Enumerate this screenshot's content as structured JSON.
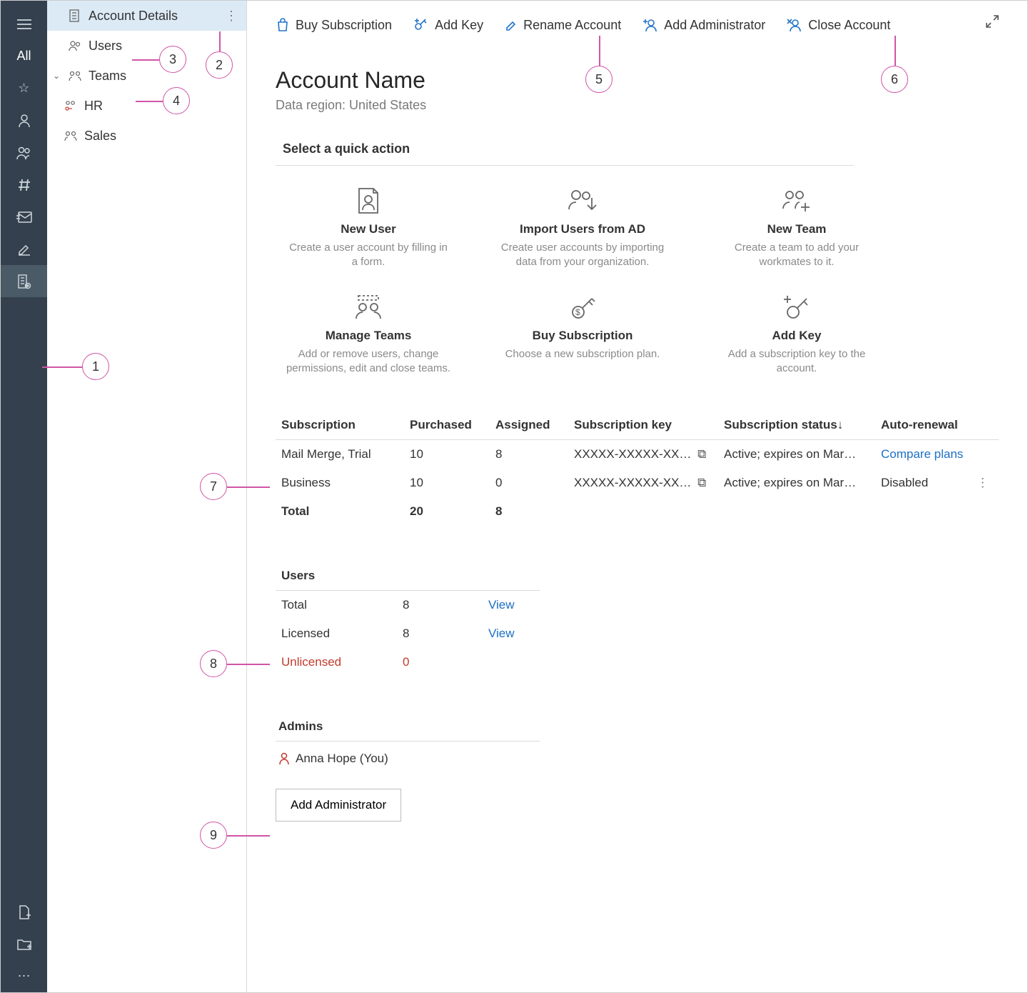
{
  "rail": {
    "text_item": "All"
  },
  "nav": {
    "account_details": "Account Details",
    "users": "Users",
    "teams": "Teams",
    "team_items": [
      "HR",
      "Sales"
    ]
  },
  "toolbar": {
    "buy": "Buy Subscription",
    "add_key": "Add Key",
    "rename": "Rename Account",
    "add_admin": "Add Administrator",
    "close": "Close Account"
  },
  "header": {
    "title": "Account Name",
    "region": "Data region: United States"
  },
  "quick_actions": {
    "title": "Select a quick action",
    "cards": [
      {
        "title": "New User",
        "desc": "Create a user account by filling in a form."
      },
      {
        "title": "Import Users from AD",
        "desc": "Create user accounts by importing data from your organization."
      },
      {
        "title": "New Team",
        "desc": "Create a team to add your workmates to it."
      },
      {
        "title": "Manage Teams",
        "desc": "Add or remove users, change permissions, edit and close teams."
      },
      {
        "title": "Buy Subscription",
        "desc": "Choose a new subscription plan."
      },
      {
        "title": "Add Key",
        "desc": "Add a subscription key to the account."
      }
    ]
  },
  "subs": {
    "headers": {
      "sub": "Subscription",
      "purchased": "Purchased",
      "assigned": "Assigned",
      "key": "Subscription key",
      "status": "Subscription status",
      "auto": "Auto-renewal"
    },
    "rows": [
      {
        "name": "Mail Merge, Trial",
        "purchased": "10",
        "assigned": "8",
        "key": "XXXXX-XXXXX-XX…",
        "status": "Active; expires on Mar…",
        "auto": "Compare plans",
        "auto_link": true
      },
      {
        "name": "Business",
        "purchased": "10",
        "assigned": "0",
        "key": "XXXXX-XXXXX-XX…",
        "status": "Active; expires on Mar…",
        "auto": "Disabled",
        "auto_link": false
      }
    ],
    "total": {
      "label": "Total",
      "purchased": "20",
      "assigned": "8"
    }
  },
  "users": {
    "header": "Users",
    "rows": [
      {
        "label": "Total",
        "value": "8",
        "action": "View",
        "red": false
      },
      {
        "label": "Licensed",
        "value": "8",
        "action": "View",
        "red": false
      },
      {
        "label": "Unlicensed",
        "value": "0",
        "action": "",
        "red": true
      }
    ]
  },
  "admins": {
    "header": "Admins",
    "list": [
      "Anna Hope (You)"
    ],
    "button": "Add Administrator"
  },
  "callouts": {
    "1": "1",
    "2": "2",
    "3": "3",
    "4": "4",
    "5": "5",
    "6": "6",
    "7": "7",
    "8": "8",
    "9": "9"
  }
}
